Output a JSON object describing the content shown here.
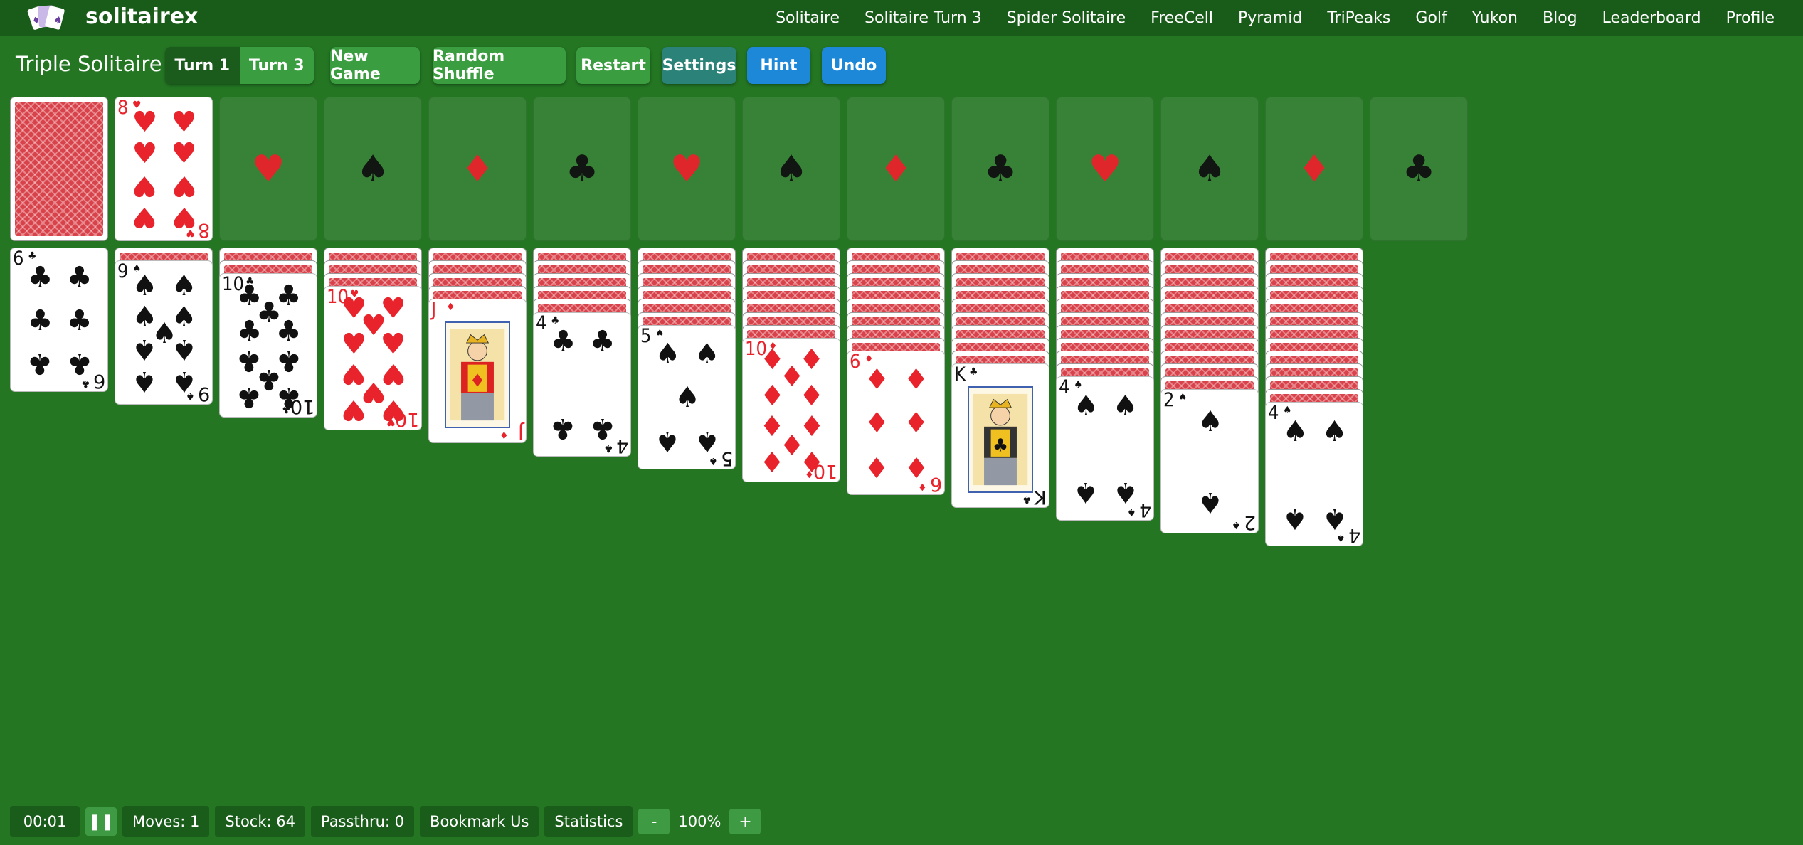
{
  "brand": "solitairex",
  "nav": [
    "Solitaire",
    "Solitaire Turn 3",
    "Spider Solitaire",
    "FreeCell",
    "Pyramid",
    "TriPeaks",
    "Golf",
    "Yukon",
    "Blog",
    "Leaderboard",
    "Profile"
  ],
  "game_title": "Triple Solitaire",
  "turn": {
    "turn1": "Turn 1",
    "turn3": "Turn 3",
    "selected": "Turn 1"
  },
  "toolbar": {
    "new_game": "New Game",
    "random_shuffle": "Random Shuffle",
    "restart": "Restart",
    "settings": "Settings",
    "hint": "Hint",
    "undo": "Undo"
  },
  "colors": {
    "table": "#247623",
    "nav": "#195c19",
    "red": "#e8232b",
    "black": "#111111",
    "blue_button": "#1e88d8",
    "green_button": "#3a9d3f",
    "teal_button": "#2a8278"
  },
  "stock": {
    "type": "face-down"
  },
  "waste": {
    "rank": "8",
    "suit": "hearts"
  },
  "foundations": [
    "hearts",
    "spades",
    "diamonds",
    "clubs",
    "hearts",
    "spades",
    "diamonds",
    "clubs",
    "hearts",
    "spades",
    "diamonds",
    "clubs"
  ],
  "tableau": [
    {
      "hidden": 0,
      "top": {
        "rank": "6",
        "suit": "clubs"
      }
    },
    {
      "hidden": 1,
      "top": {
        "rank": "9",
        "suit": "spades"
      }
    },
    {
      "hidden": 2,
      "top": {
        "rank": "10",
        "suit": "clubs"
      }
    },
    {
      "hidden": 3,
      "top": {
        "rank": "10",
        "suit": "hearts"
      }
    },
    {
      "hidden": 4,
      "top": {
        "rank": "J",
        "suit": "diamonds"
      }
    },
    {
      "hidden": 5,
      "top": {
        "rank": "4",
        "suit": "clubs"
      }
    },
    {
      "hidden": 6,
      "top": {
        "rank": "5",
        "suit": "spades"
      }
    },
    {
      "hidden": 7,
      "top": {
        "rank": "10",
        "suit": "diamonds"
      }
    },
    {
      "hidden": 8,
      "top": {
        "rank": "6",
        "suit": "diamonds"
      }
    },
    {
      "hidden": 9,
      "top": {
        "rank": "K",
        "suit": "clubs"
      }
    },
    {
      "hidden": 10,
      "top": {
        "rank": "4",
        "suit": "spades"
      }
    },
    {
      "hidden": 11,
      "top": {
        "rank": "2",
        "suit": "spades"
      }
    },
    {
      "hidden": 12,
      "top": {
        "rank": "4",
        "suit": "spades"
      }
    }
  ],
  "status": {
    "timer": "00:01",
    "pause_icon": "pause-icon",
    "moves": "Moves: 1",
    "stock": "Stock: 64",
    "passthrus": "Passthru: 0",
    "bookmark": "Bookmark Us",
    "statistics": "Statistics",
    "zoom_out": "-",
    "zoom": "100%",
    "zoom_in": "+"
  }
}
